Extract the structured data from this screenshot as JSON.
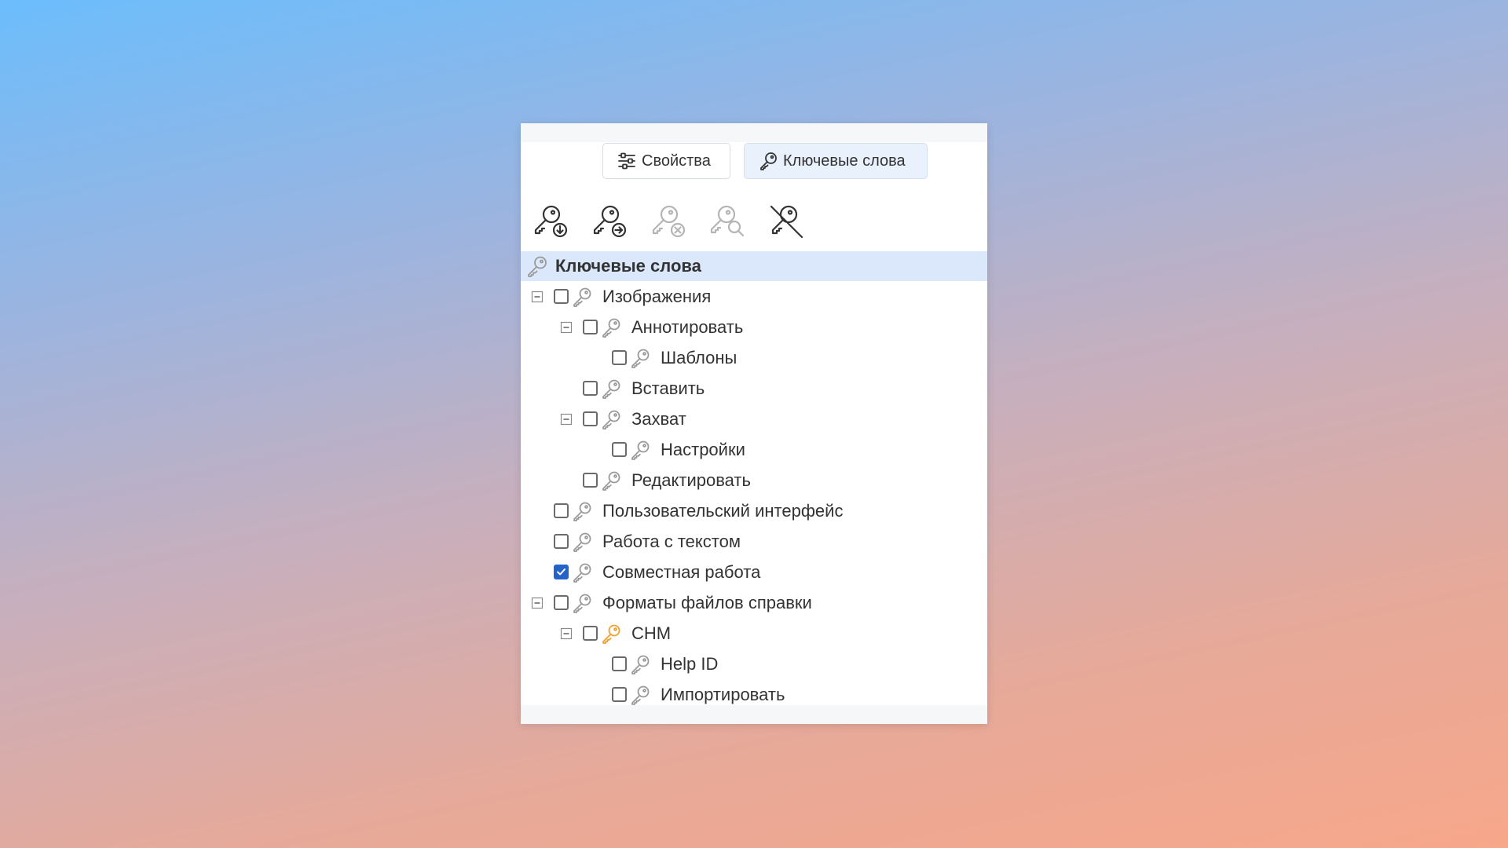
{
  "tabs": [
    {
      "label": "Свойства",
      "icon": "sliders-icon",
      "active": false
    },
    {
      "label": "Ключевые слова",
      "icon": "key-icon",
      "active": true
    }
  ],
  "toolbar": [
    {
      "name": "add-keyword",
      "icon": "key-download-icon",
      "enabled": true
    },
    {
      "name": "assign-keyword",
      "icon": "key-arrow-right-icon",
      "enabled": true
    },
    {
      "name": "remove-keyword",
      "icon": "key-remove-icon",
      "enabled": false
    },
    {
      "name": "find-keyword",
      "icon": "key-search-icon",
      "enabled": false
    },
    {
      "name": "clear-keywords",
      "icon": "key-crossed-icon",
      "enabled": true
    }
  ],
  "tree": {
    "header": "Ключевые слова",
    "items": [
      {
        "label": "Изображения",
        "level": 0,
        "expandable": true,
        "checked": false,
        "key_color": "gray"
      },
      {
        "label": "Аннотировать",
        "level": 1,
        "expandable": true,
        "checked": false,
        "key_color": "gray"
      },
      {
        "label": "Шаблоны",
        "level": 2,
        "expandable": false,
        "checked": false,
        "key_color": "gray"
      },
      {
        "label": "Вставить",
        "level": 1,
        "expandable": false,
        "checked": false,
        "key_color": "gray"
      },
      {
        "label": "Захват",
        "level": 1,
        "expandable": true,
        "checked": false,
        "key_color": "gray"
      },
      {
        "label": "Настройки",
        "level": 2,
        "expandable": false,
        "checked": false,
        "key_color": "gray"
      },
      {
        "label": "Редактировать",
        "level": 1,
        "expandable": false,
        "checked": false,
        "key_color": "gray"
      },
      {
        "label": "Пользовательский интерфейс",
        "level": 0,
        "expandable": false,
        "checked": false,
        "key_color": "gray"
      },
      {
        "label": "Работа с текстом",
        "level": 0,
        "expandable": false,
        "checked": false,
        "key_color": "gray"
      },
      {
        "label": "Совместная работа",
        "level": 0,
        "expandable": false,
        "checked": true,
        "key_color": "gray"
      },
      {
        "label": "Форматы файлов справки",
        "level": 0,
        "expandable": true,
        "checked": false,
        "key_color": "gray"
      },
      {
        "label": "CHM",
        "level": 1,
        "expandable": true,
        "checked": false,
        "key_color": "orange"
      },
      {
        "label": "Help ID",
        "level": 2,
        "expandable": false,
        "checked": false,
        "key_color": "gray"
      },
      {
        "label": "Импортировать",
        "level": 2,
        "expandable": false,
        "checked": false,
        "key_color": "gray"
      }
    ]
  },
  "colors": {
    "accent": "#2463c7",
    "header_bg": "#dbe8fb",
    "key_gray": "#9a9a9a",
    "key_orange": "#f0a030",
    "icon_dark": "#333333",
    "icon_disabled": "#b5b5b5"
  }
}
